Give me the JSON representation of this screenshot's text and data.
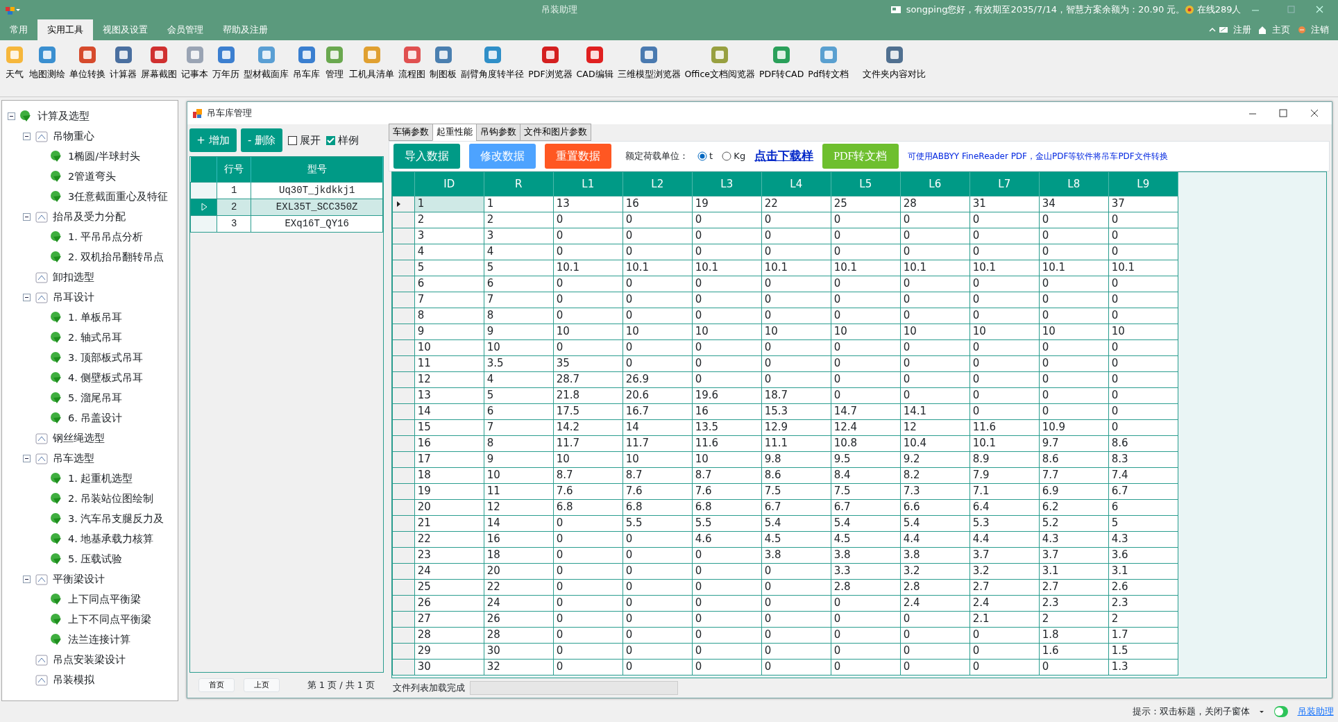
{
  "app": {
    "title": "吊装助理",
    "user_info": "songping您好，有效期至2035/7/14，智慧方案余额为：20.90 元。",
    "online": "在线289人"
  },
  "menu_tabs": [
    {
      "label": "常用",
      "selected": false
    },
    {
      "label": "实用工具",
      "selected": true
    },
    {
      "label": "视图及设置",
      "selected": false
    },
    {
      "label": "会员管理",
      "selected": false
    },
    {
      "label": "帮助及注册",
      "selected": false
    }
  ],
  "account_links": [
    "注册",
    "主页",
    "注销"
  ],
  "toolbar": [
    "天气",
    "地图测绘",
    "单位转换",
    "计算器",
    "屏幕截图",
    "记事本",
    "万年历",
    "型材截面库",
    "吊车库",
    "管理",
    "工机具清单",
    "流程图",
    "制图板",
    "副臂角度转半径",
    "PDF浏览器",
    "CAD编辑",
    "三维模型浏览器",
    "Office文档阅览器",
    "PDF转CAD",
    "Pdf转文档",
    "文件夹内容对比"
  ],
  "tree": [
    {
      "label": "计算及选型",
      "expanded": true,
      "children": [
        {
          "label": "吊物重心",
          "expanded": true,
          "children": [
            {
              "label": "1椭圆/半球封头"
            },
            {
              "label": "2管道弯头"
            },
            {
              "label": "3任意截面重心及特征"
            }
          ]
        },
        {
          "label": "抬吊及受力分配",
          "expanded": true,
          "children": [
            {
              "label": "1. 平吊吊点分析"
            },
            {
              "label": "2. 双机抬吊翻转吊点"
            }
          ]
        },
        {
          "label": "卸扣选型"
        },
        {
          "label": "吊耳设计",
          "expanded": true,
          "children": [
            {
              "label": "1. 单板吊耳"
            },
            {
              "label": "2. 轴式吊耳"
            },
            {
              "label": "3. 顶部板式吊耳"
            },
            {
              "label": "4. 侧壁板式吊耳"
            },
            {
              "label": "5. 溜尾吊耳"
            },
            {
              "label": "6. 吊盖设计"
            }
          ]
        },
        {
          "label": "钢丝绳选型"
        },
        {
          "label": "吊车选型",
          "expanded": true,
          "children": [
            {
              "label": "1. 起重机选型"
            },
            {
              "label": "2. 吊装站位图绘制"
            },
            {
              "label": "3. 汽车吊支腿反力及"
            },
            {
              "label": "4. 地基承载力核算"
            },
            {
              "label": "5. 压载试验"
            }
          ]
        },
        {
          "label": "平衡梁设计",
          "expanded": true,
          "children": [
            {
              "label": "上下同点平衡梁"
            },
            {
              "label": "上下不同点平衡梁"
            },
            {
              "label": "法兰连接计算"
            }
          ]
        },
        {
          "label": "吊点安装梁设计"
        },
        {
          "label": "吊装模拟"
        }
      ]
    }
  ],
  "child_window": {
    "title": "吊车库管理",
    "left": {
      "buttons": [
        "+ 增加",
        "- 删除"
      ],
      "checkboxes": [
        {
          "label": "展开",
          "checked": false
        },
        {
          "label": "样例",
          "checked": true
        }
      ],
      "columns": [
        "行号",
        "型号"
      ],
      "rows": [
        {
          "cells": [
            "1",
            "Uq30T_jkdkkj1"
          ],
          "selected": false
        },
        {
          "cells": [
            "2",
            "EXL35T_SCC350Z"
          ],
          "selected": true
        },
        {
          "cells": [
            "3",
            "EXq16T_QY16"
          ],
          "selected": false
        }
      ],
      "pager_buttons": [
        "首页",
        "上页"
      ],
      "pager_info": "第 1 页 / 共 1 页"
    },
    "right": {
      "tabs": [
        {
          "label": "车辆参数",
          "selected": false
        },
        {
          "label": "起重性能",
          "selected": true
        },
        {
          "label": "吊钩参数",
          "selected": false
        },
        {
          "label": "文件和图片参数",
          "selected": false
        }
      ],
      "actions": [
        {
          "label": "导入数据",
          "color": "#009a86"
        },
        {
          "label": "修改数据",
          "color": "#4da3ff"
        },
        {
          "label": "重置数据",
          "color": "#ff5722"
        }
      ],
      "unit_label": "额定荷载单位：",
      "units": [
        {
          "label": "t",
          "selected": true
        },
        {
          "label": "Kg",
          "selected": false
        }
      ],
      "download_link": "点击下载样",
      "pdf_button": "PDF转文档",
      "hint": "可使用ABBYY FineReader PDF，金山PDF等软件将吊车PDF文件转换",
      "columns": [
        "ID",
        "R",
        "L1",
        "L2",
        "L3",
        "L4",
        "L5",
        "L6",
        "L7",
        "L8",
        "L9"
      ],
      "rows": [
        {
          "cells": [
            "1",
            "1",
            "13",
            "16",
            "19",
            "22",
            "25",
            "28",
            "31",
            "34",
            "37"
          ],
          "selected": true
        },
        {
          "cells": [
            "2",
            "2",
            "0",
            "0",
            "0",
            "0",
            "0",
            "0",
            "0",
            "0",
            "0"
          ],
          "selected": false
        },
        {
          "cells": [
            "3",
            "3",
            "0",
            "0",
            "0",
            "0",
            "0",
            "0",
            "0",
            "0",
            "0"
          ],
          "selected": false
        },
        {
          "cells": [
            "4",
            "4",
            "0",
            "0",
            "0",
            "0",
            "0",
            "0",
            "0",
            "0",
            "0"
          ],
          "selected": false
        },
        {
          "cells": [
            "5",
            "5",
            "10.1",
            "10.1",
            "10.1",
            "10.1",
            "10.1",
            "10.1",
            "10.1",
            "10.1",
            "10.1"
          ],
          "selected": false
        },
        {
          "cells": [
            "6",
            "6",
            "0",
            "0",
            "0",
            "0",
            "0",
            "0",
            "0",
            "0",
            "0"
          ],
          "selected": false
        },
        {
          "cells": [
            "7",
            "7",
            "0",
            "0",
            "0",
            "0",
            "0",
            "0",
            "0",
            "0",
            "0"
          ],
          "selected": false
        },
        {
          "cells": [
            "8",
            "8",
            "0",
            "0",
            "0",
            "0",
            "0",
            "0",
            "0",
            "0",
            "0"
          ],
          "selected": false
        },
        {
          "cells": [
            "9",
            "9",
            "10",
            "10",
            "10",
            "10",
            "10",
            "10",
            "10",
            "10",
            "10"
          ],
          "selected": false
        },
        {
          "cells": [
            "10",
            "10",
            "0",
            "0",
            "0",
            "0",
            "0",
            "0",
            "0",
            "0",
            "0"
          ],
          "selected": false
        },
        {
          "cells": [
            "11",
            "3.5",
            "35",
            "0",
            "0",
            "0",
            "0",
            "0",
            "0",
            "0",
            "0"
          ],
          "selected": false
        },
        {
          "cells": [
            "12",
            "4",
            "28.7",
            "26.9",
            "0",
            "0",
            "0",
            "0",
            "0",
            "0",
            "0"
          ],
          "selected": false
        },
        {
          "cells": [
            "13",
            "5",
            "21.8",
            "20.6",
            "19.6",
            "18.7",
            "0",
            "0",
            "0",
            "0",
            "0"
          ],
          "selected": false
        },
        {
          "cells": [
            "14",
            "6",
            "17.5",
            "16.7",
            "16",
            "15.3",
            "14.7",
            "14.1",
            "0",
            "0",
            "0"
          ],
          "selected": false
        },
        {
          "cells": [
            "15",
            "7",
            "14.2",
            "14",
            "13.5",
            "12.9",
            "12.4",
            "12",
            "11.6",
            "10.9",
            "0"
          ],
          "selected": false
        },
        {
          "cells": [
            "16",
            "8",
            "11.7",
            "11.7",
            "11.6",
            "11.1",
            "10.8",
            "10.4",
            "10.1",
            "9.7",
            "8.6"
          ],
          "selected": false
        },
        {
          "cells": [
            "17",
            "9",
            "10",
            "10",
            "10",
            "9.8",
            "9.5",
            "9.2",
            "8.9",
            "8.6",
            "8.3"
          ],
          "selected": false
        },
        {
          "cells": [
            "18",
            "10",
            "8.7",
            "8.7",
            "8.7",
            "8.6",
            "8.4",
            "8.2",
            "7.9",
            "7.7",
            "7.4"
          ],
          "selected": false
        },
        {
          "cells": [
            "19",
            "11",
            "7.6",
            "7.6",
            "7.6",
            "7.5",
            "7.5",
            "7.3",
            "7.1",
            "6.9",
            "6.7"
          ],
          "selected": false
        },
        {
          "cells": [
            "20",
            "12",
            "6.8",
            "6.8",
            "6.8",
            "6.7",
            "6.7",
            "6.6",
            "6.4",
            "6.2",
            "6"
          ],
          "selected": false
        },
        {
          "cells": [
            "21",
            "14",
            "0",
            "5.5",
            "5.5",
            "5.4",
            "5.4",
            "5.4",
            "5.3",
            "5.2",
            "5"
          ],
          "selected": false
        },
        {
          "cells": [
            "22",
            "16",
            "0",
            "0",
            "4.6",
            "4.5",
            "4.5",
            "4.4",
            "4.4",
            "4.3",
            "4.3"
          ],
          "selected": false
        },
        {
          "cells": [
            "23",
            "18",
            "0",
            "0",
            "0",
            "3.8",
            "3.8",
            "3.8",
            "3.7",
            "3.7",
            "3.6"
          ],
          "selected": false
        },
        {
          "cells": [
            "24",
            "20",
            "0",
            "0",
            "0",
            "0",
            "3.3",
            "3.2",
            "3.2",
            "3.1",
            "3.1"
          ],
          "selected": false
        },
        {
          "cells": [
            "25",
            "22",
            "0",
            "0",
            "0",
            "0",
            "2.8",
            "2.8",
            "2.7",
            "2.7",
            "2.6"
          ],
          "selected": false
        },
        {
          "cells": [
            "26",
            "24",
            "0",
            "0",
            "0",
            "0",
            "0",
            "2.4",
            "2.4",
            "2.3",
            "2.3"
          ],
          "selected": false
        },
        {
          "cells": [
            "27",
            "26",
            "0",
            "0",
            "0",
            "0",
            "0",
            "0",
            "2.1",
            "2",
            "2"
          ],
          "selected": false
        },
        {
          "cells": [
            "28",
            "28",
            "0",
            "0",
            "0",
            "0",
            "0",
            "0",
            "0",
            "1.8",
            "1.7"
          ],
          "selected": false
        },
        {
          "cells": [
            "29",
            "30",
            "0",
            "0",
            "0",
            "0",
            "0",
            "0",
            "0",
            "1.6",
            "1.5"
          ],
          "selected": false
        },
        {
          "cells": [
            "30",
            "32",
            "0",
            "0",
            "0",
            "0",
            "0",
            "0",
            "0",
            "0",
            "1.3"
          ],
          "selected": false
        }
      ],
      "status": "文件列表加载完成"
    }
  },
  "status_bar": {
    "hint": "提示：双击标题，关闭子窗体",
    "toggle_on": true,
    "link": "吊装助理"
  }
}
